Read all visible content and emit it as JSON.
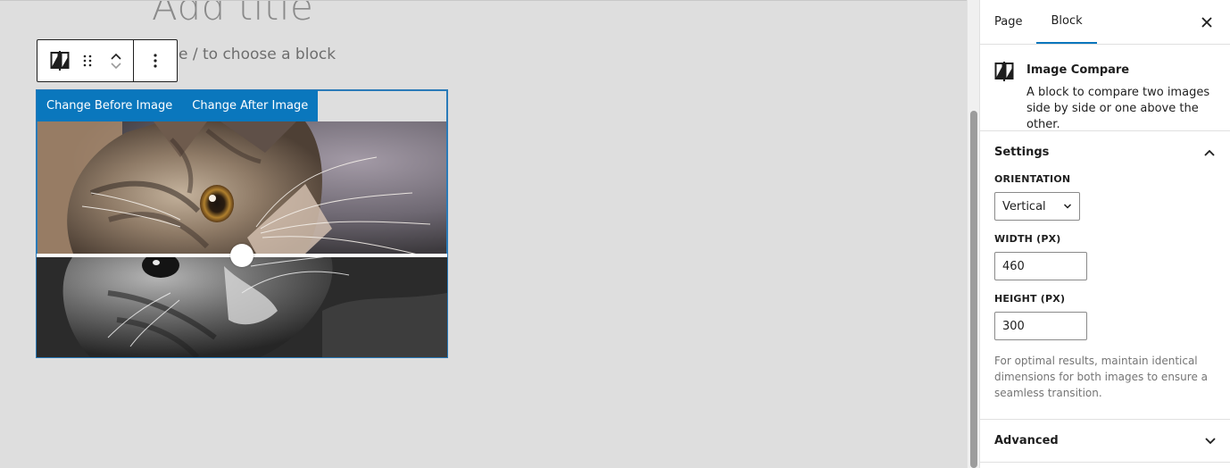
{
  "canvas": {
    "post_title": "Add title",
    "block_hint": "e / to choose a block"
  },
  "toolbar": {
    "block_icon": "image-compare-icon",
    "drag_icon": "drag-handle-icon",
    "move_up_icon": "chevron-up-icon",
    "move_down_icon": "chevron-down-icon",
    "more_icon": "more-vertical-icon"
  },
  "compare_block": {
    "change_before_label": "Change Before Image",
    "change_after_label": "Change After Image",
    "before_image_alt": "kitten photo (color)",
    "after_image_alt": "kitten photo (grayscale)"
  },
  "sidebar": {
    "tabs": [
      {
        "label": "Page",
        "active": false
      },
      {
        "label": "Block",
        "active": true
      }
    ],
    "close_icon": "close-icon",
    "block_card": {
      "icon": "image-compare-icon",
      "title": "Image Compare",
      "description": "A block to compare two images side by side or one above the other."
    },
    "settings": {
      "title": "Settings",
      "orientation_label": "ORIENTATION",
      "orientation_value": "Vertical",
      "width_label": "WIDTH (PX)",
      "width_value": "460",
      "height_label": "HEIGHT (PX)",
      "height_value": "300",
      "help_text": "For optimal results, maintain identical dimensions for both images to ensure a seamless transition."
    },
    "advanced": {
      "title": "Advanced"
    }
  },
  "colors": {
    "accent": "#0a77bd",
    "canvas_bg": "#dedede",
    "selection_outline": "#2a7ab8"
  }
}
